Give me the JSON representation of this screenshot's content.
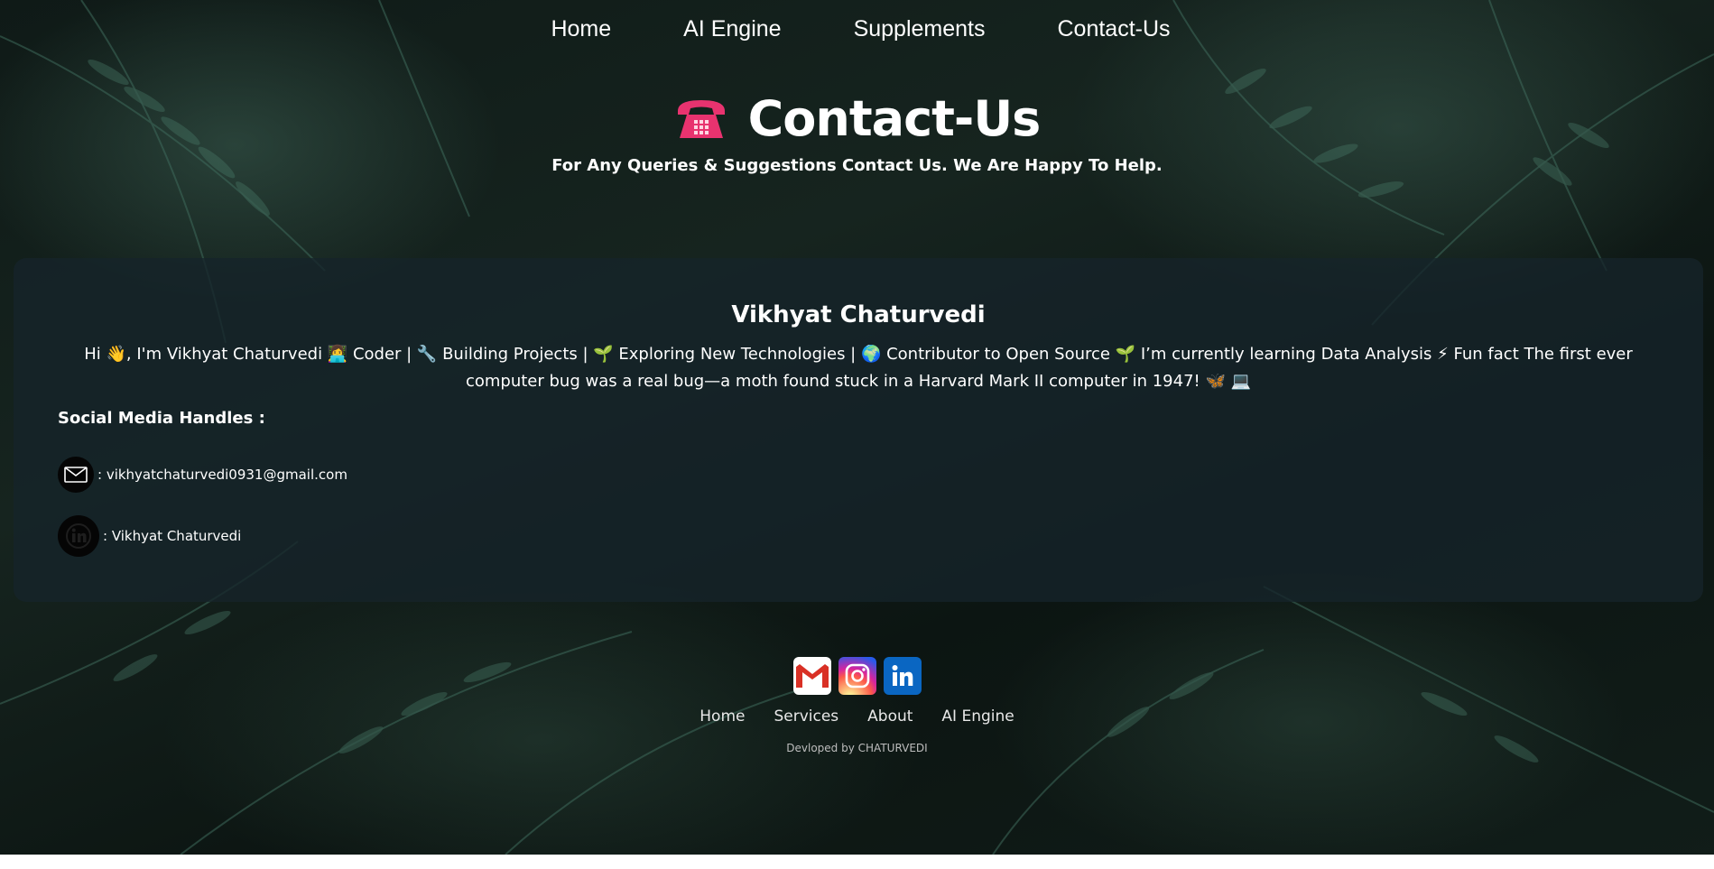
{
  "nav": {
    "items": [
      {
        "label": "Home"
      },
      {
        "label": "AI Engine"
      },
      {
        "label": "Supplements"
      },
      {
        "label": "Contact-Us"
      }
    ]
  },
  "hero": {
    "icon": "telephone-icon",
    "title": "Contact-Us",
    "subtitle": "For Any Queries & Suggestions Contact Us. We Are Happy To Help."
  },
  "profile": {
    "name": "Vikhyat Chaturvedi",
    "bio": "Hi 👋, I'm Vikhyat Chaturvedi 👩‍💻 Coder | 🔧 Building Projects | 🌱 Exploring New Technologies | 🌍 Contributor to Open Source 🌱 I’m currently learning Data Analysis ⚡ Fun fact The first ever computer bug was a real bug—a moth found stuck in a Harvard Mark II computer in 1947! 🦋 💻",
    "social_title": "Social Media Handles :",
    "email_text": ": vikhyatchaturvedi0931@gmail.com",
    "linkedin_text": ": Vikhyat Chaturvedi"
  },
  "footer": {
    "icons": [
      "gmail-icon",
      "instagram-icon",
      "linkedin-icon"
    ],
    "links": [
      {
        "label": "Home"
      },
      {
        "label": "Services"
      },
      {
        "label": "About"
      },
      {
        "label": "AI Engine"
      }
    ],
    "credit": "Devloped by CHATURVEDI"
  },
  "colors": {
    "card_bg": "#16242a",
    "phone_icon": "#e8336f",
    "linkedin_brand": "#0a66c2",
    "gmail_red": "#d93025"
  }
}
